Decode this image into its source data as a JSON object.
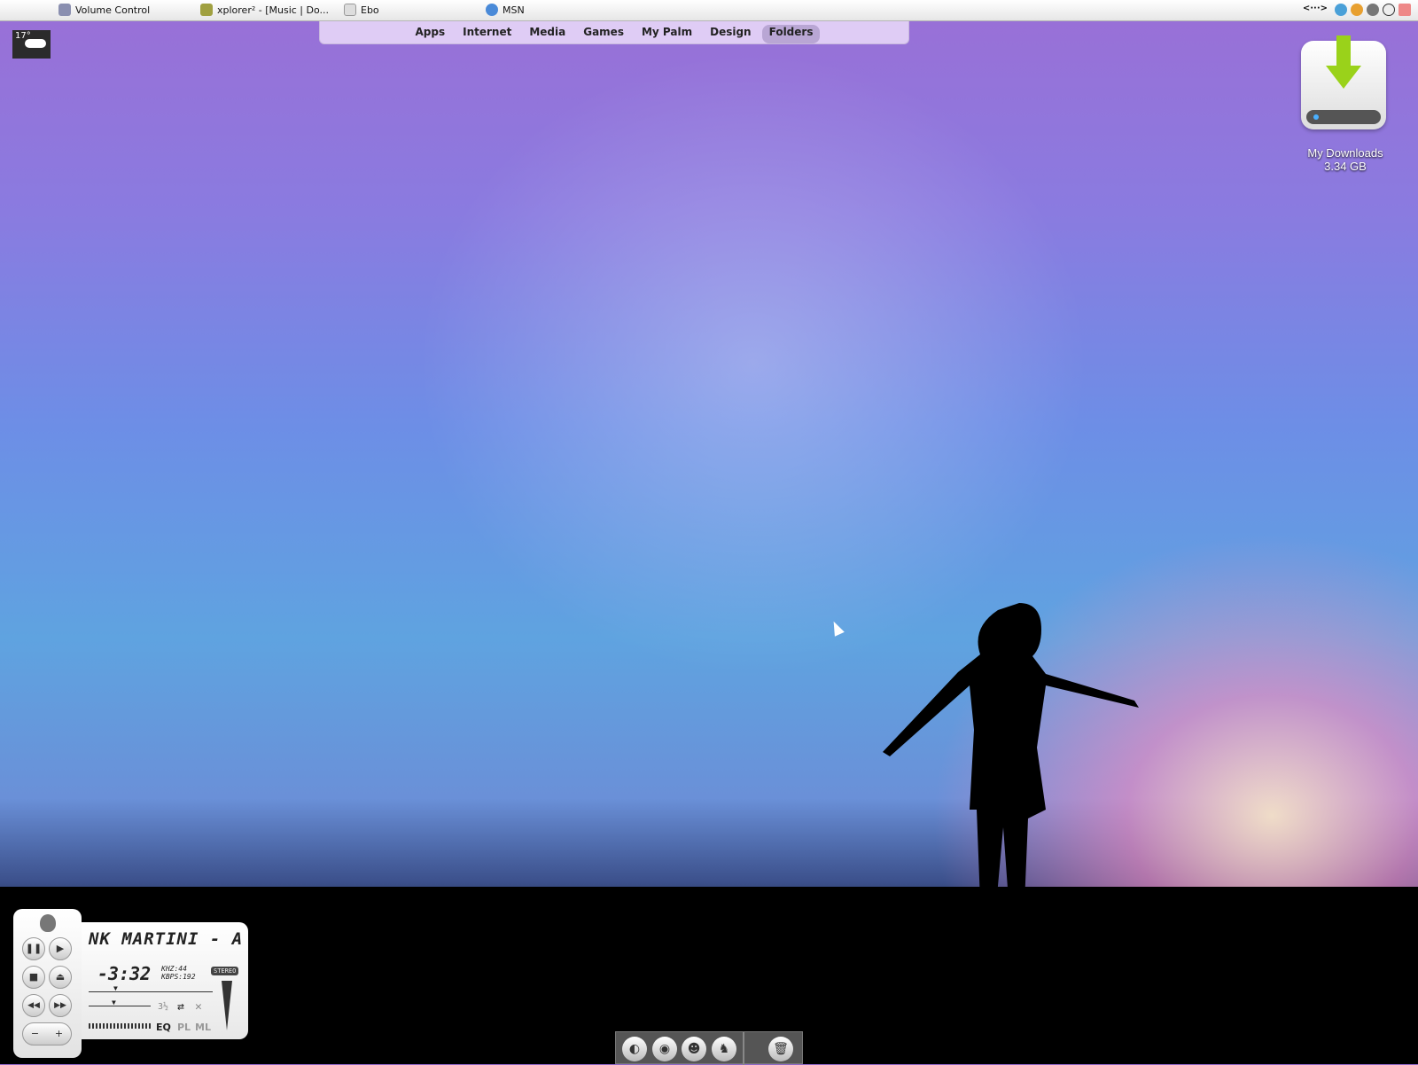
{
  "taskbar": {
    "tasks": [
      {
        "label": "Volume Control"
      },
      {
        "label": "xplorer² - [Music | Do..."
      },
      {
        "label": "Ebo"
      },
      {
        "label": "MSN"
      }
    ],
    "tray_label": "<···>"
  },
  "menu": {
    "items": [
      "Apps",
      "Internet",
      "Media",
      "Games",
      "My Palm",
      "Design",
      "Folders"
    ],
    "active": "Folders"
  },
  "weather": {
    "temp": "17°",
    "condition": "cloudy"
  },
  "desktop": {
    "drive": {
      "name": "My Downloads",
      "size": "3.34 GB"
    }
  },
  "player": {
    "title": "NK MARTINI - A",
    "time": "-3:32",
    "khz": "KHZ:44",
    "kbps": "KBPS:192",
    "stereo": "STEREO",
    "eq": "EQ",
    "pl": "PL",
    "ml": "ML",
    "shuffle": "3½",
    "pause": "❚❚",
    "play": "▶",
    "stop": "■",
    "eject": "⏏",
    "prev": "◀◀",
    "next": "▶▶",
    "minus": "−",
    "plus": "+"
  },
  "dock": {
    "items": [
      {
        "icon": "msn-icon",
        "glyph": "◐"
      },
      {
        "icon": "firefox-icon",
        "glyph": "◉"
      },
      {
        "icon": "contacts-icon",
        "glyph": "☻"
      },
      {
        "icon": "user-icon",
        "glyph": "♞"
      },
      {
        "icon": "trash-icon",
        "glyph": "🗑"
      }
    ]
  },
  "colors": {
    "drive_arrow": "#9ad21a"
  }
}
